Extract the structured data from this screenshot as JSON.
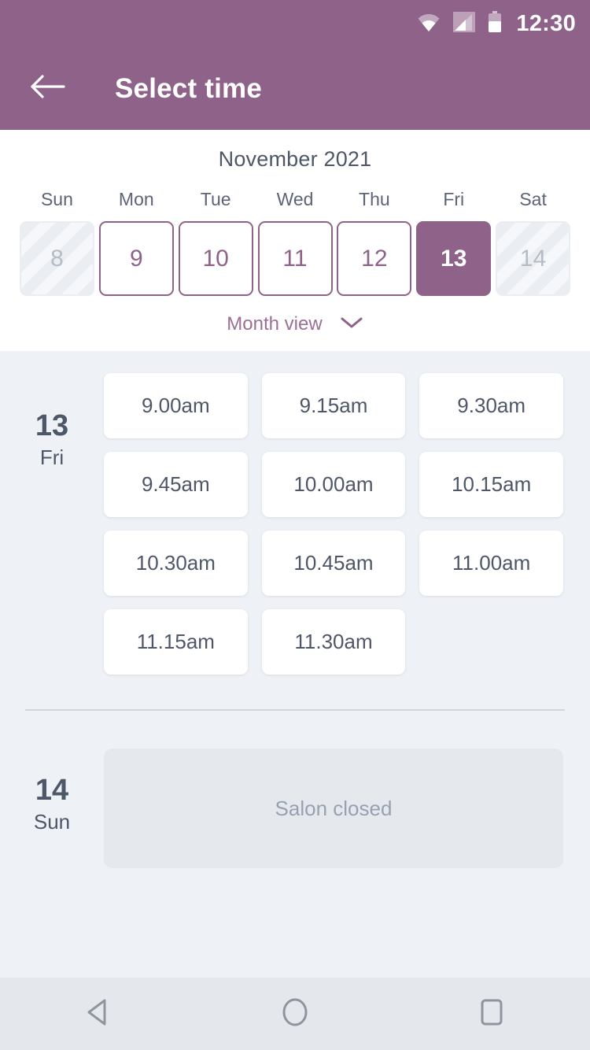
{
  "status_bar": {
    "time": "12:30",
    "icons": [
      "wifi-icon",
      "signal-icon",
      "battery-icon"
    ]
  },
  "app_bar": {
    "back_icon": "back-arrow-icon",
    "title": "Select time"
  },
  "calendar": {
    "month_title": "November 2021",
    "weekdays": [
      "Sun",
      "Mon",
      "Tue",
      "Wed",
      "Thu",
      "Fri",
      "Sat"
    ],
    "days": [
      {
        "num": "8",
        "state": "disabled"
      },
      {
        "num": "9",
        "state": "enabled"
      },
      {
        "num": "10",
        "state": "enabled"
      },
      {
        "num": "11",
        "state": "enabled"
      },
      {
        "num": "12",
        "state": "enabled"
      },
      {
        "num": "13",
        "state": "selected"
      },
      {
        "num": "14",
        "state": "disabled"
      }
    ],
    "month_view_label": "Month view",
    "month_view_icon": "chevron-down-icon"
  },
  "schedule": {
    "days": [
      {
        "day_num": "13",
        "day_of_week": "Fri",
        "slots": [
          "9.00am",
          "9.15am",
          "9.30am",
          "9.45am",
          "10.00am",
          "10.15am",
          "10.30am",
          "10.45am",
          "11.00am",
          "11.15am",
          "11.30am"
        ]
      },
      {
        "day_num": "14",
        "day_of_week": "Sun",
        "closed_label": "Salon closed"
      }
    ]
  },
  "nav_bar": {
    "back_icon": "nav-back-triangle-icon",
    "home_icon": "nav-home-circle-icon",
    "recents_icon": "nav-recents-square-icon"
  },
  "colors": {
    "brand_purple": "#8e6289",
    "slate_text": "#4d5768",
    "page_bg": "#eef1f5",
    "card_bg": "#ffffff",
    "closed_bg": "#e5e9ee",
    "nav_bg": "#e4e7ec"
  }
}
